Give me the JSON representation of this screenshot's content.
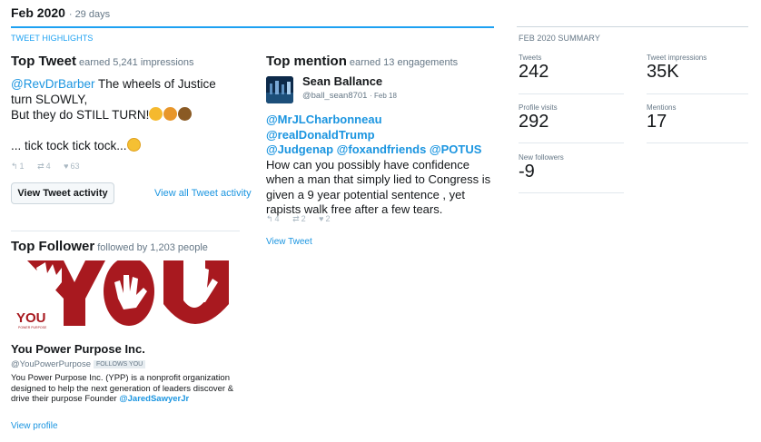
{
  "header": {
    "month": "Feb 2020",
    "days": "29 days"
  },
  "highlights": {
    "section_label": "TWEET HIGHLIGHTS",
    "top_tweet": {
      "title": "Top Tweet",
      "subtitle": "earned 5,241 impressions",
      "mention": "@RevDrBarber",
      "text_1": "The wheels of Justice turn SLOWLY,",
      "text_2": "But they do STILL TURN!",
      "text_3": "... tick tock tick tock...",
      "replies": "1",
      "retweets": "4",
      "likes": "63",
      "activity_button": "View Tweet activity",
      "view_all_link": "View all Tweet activity"
    },
    "top_mention": {
      "title": "Top mention",
      "subtitle": "earned 13 engagements",
      "user_name": "Sean Ballance",
      "user_handle": "@ball_sean8701",
      "date": "Feb 18",
      "mentions_1": "@MrJLCharbonneau @realDonaldTrump",
      "mentions_2": "@Judgenap @foxandfriends @POTUS",
      "text": "How can you possibly have confidence when a man that simply lied to Congress is given a 9 year potential sentence , yet rapists walk free after a few tears.",
      "replies": "4",
      "retweets": "2",
      "likes": "2",
      "view_link": "View Tweet"
    },
    "top_follower": {
      "title": "Top Follower",
      "subtitle": "followed by 1,203 people",
      "banner_text": "YOU",
      "banner_tagline": "POWER PURPOSE",
      "name": "You Power Purpose Inc.",
      "handle": "@YouPowerPurpose",
      "badge": "FOLLOWS YOU",
      "bio": "You Power Purpose Inc. (YPP) is a nonprofit organization designed to help the next generation of leaders discover & drive their purpose Founder",
      "bio_mention": "@JaredSawyerJr",
      "profile_link": "View profile"
    }
  },
  "summary": {
    "section_label": "FEB 2020 SUMMARY",
    "tweets_label": "Tweets",
    "tweets_value": "242",
    "impressions_label": "Tweet impressions",
    "impressions_value": "35K",
    "profile_visits_label": "Profile visits",
    "profile_visits_value": "292",
    "mentions_label": "Mentions",
    "mentions_value": "17",
    "new_followers_label": "New followers",
    "new_followers_value": "-9"
  },
  "icons": {
    "reply": "reply-icon",
    "retweet": "retweet-icon",
    "like": "heart-icon"
  },
  "colors": {
    "accent": "#1da1f2",
    "link": "#1b95e0",
    "brand_red": "#b01e23"
  }
}
